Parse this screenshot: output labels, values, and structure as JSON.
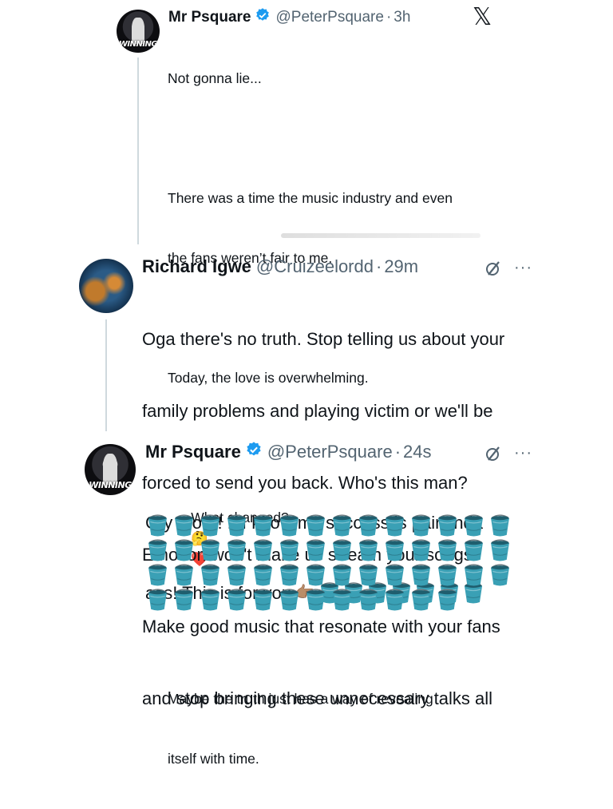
{
  "tweets": [
    {
      "name": "Mr Psquare",
      "handle": "@PeterPsquare",
      "time": "3h",
      "avatar_text": "WINNING",
      "lines": [
        "Not gonna lie...",
        "",
        "There was a time the music industry and even",
        "the fans weren’t fair to me.",
        "",
        "Today, the love is overwhelming.",
        "",
        "What changed?",
        "",
        "Maybe the truth just has a way of revealing",
        "itself with time."
      ]
    },
    {
      "name": "Richard Igwe",
      "handle": "@Cruizeelordd",
      "time": "29m",
      "lines": [
        "Oga there's no truth. Stop telling us about your",
        "family problems and playing victim or we'll be",
        "forced to send you back. Who's this man?",
        "Emotion won't make us stream your songs.",
        "Make good music that resonate with your fans",
        "and stop bringing these unnecessary talks all"
      ]
    },
    {
      "name": "Mr Psquare",
      "handle": "@PeterPsquare",
      "time": "24s",
      "avatar_text": "WINNING",
      "lines": [
        "Cry more! .. I know my success is pain inda",
        "ass! This is for you"
      ]
    }
  ],
  "icons": {
    "x_logo": "𝕏",
    "more": "···",
    "verified_color": "#1d9bf0",
    "bucket_color": "#3aa0b5"
  },
  "emoji": {
    "thinking": "🤔",
    "heart": "❤️",
    "pointing": "👉🏽"
  },
  "buckets": {
    "inline_row": 7,
    "rows": [
      14,
      14,
      14,
      12
    ]
  }
}
